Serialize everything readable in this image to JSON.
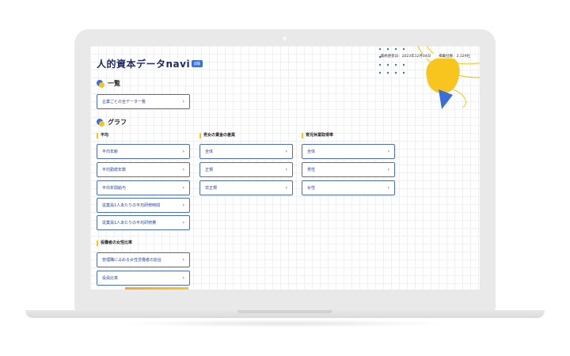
{
  "site": {
    "logo_text": "人的資本データnavi",
    "badge": "β版"
  },
  "meta": {
    "updated": "最終更新日：2023年12月04日",
    "count": "掲載社数：2,329社"
  },
  "sections": {
    "list": {
      "title": "一覧",
      "buttons": [
        "企業ごとの全データ一覧"
      ]
    },
    "graph": {
      "title": "グラフ"
    }
  },
  "columns": {
    "avg": {
      "head": "平均",
      "buttons": [
        "平均年齢",
        "平均勤続年数",
        "平均年間給与",
        "従業員1人あたりの平均研修時間",
        "従業員1人あたりの平均研修費"
      ]
    },
    "wage": {
      "head": "男女の賃金の差異",
      "buttons": [
        "全体",
        "正規",
        "非正規"
      ]
    },
    "leave": {
      "head": "育児休業取得率",
      "buttons": [
        "全体",
        "男性",
        "女性"
      ]
    },
    "female": {
      "head": "役職者の女性比率",
      "buttons": [
        "管理職に占める女性労働者の割合",
        "役員比率"
      ]
    }
  },
  "colors": {
    "accent_blue": "#3a6fd8",
    "accent_yellow": "#f7c51e",
    "button_border": "#4a6cd0"
  },
  "icons": {
    "chevron": "›"
  }
}
